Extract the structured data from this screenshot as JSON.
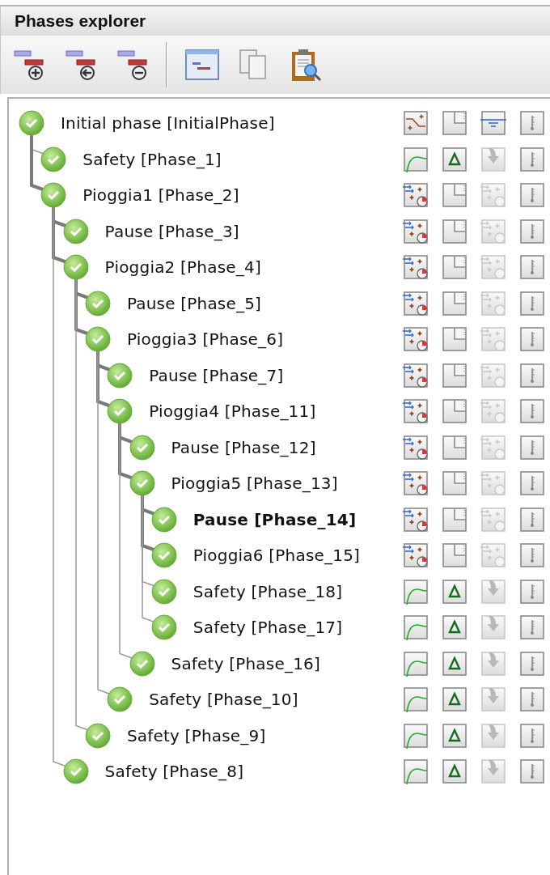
{
  "panel": {
    "title": "Phases explorer"
  },
  "phases": [
    {
      "name": "Initial phase [InitialPhase]",
      "kind": "initial",
      "selected": false,
      "children": [
        {
          "name": "Safety [Phase_1]",
          "kind": "safety",
          "selected": false
        },
        {
          "name": "Pioggia1 [Phase_2]",
          "kind": "plastic",
          "selected": false,
          "children": [
            {
              "name": "Pause [Phase_3]",
              "kind": "plastic",
              "selected": false
            },
            {
              "name": "Pioggia2 [Phase_4]",
              "kind": "plastic",
              "selected": false,
              "children": [
                {
                  "name": "Pause [Phase_5]",
                  "kind": "plastic",
                  "selected": false
                },
                {
                  "name": "Pioggia3 [Phase_6]",
                  "kind": "plastic",
                  "selected": false,
                  "children": [
                    {
                      "name": "Pause [Phase_7]",
                      "kind": "plastic",
                      "selected": false
                    },
                    {
                      "name": "Pioggia4 [Phase_11]",
                      "kind": "plastic",
                      "selected": false,
                      "children": [
                        {
                          "name": "Pause [Phase_12]",
                          "kind": "plastic",
                          "selected": false
                        },
                        {
                          "name": "Pioggia5 [Phase_13]",
                          "kind": "plastic",
                          "selected": false,
                          "children": [
                            {
                              "name": "Pause [Phase_14]",
                              "kind": "plastic",
                              "selected": true
                            },
                            {
                              "name": "Pioggia6 [Phase_15]",
                              "kind": "plastic",
                              "selected": false
                            },
                            {
                              "name": "Safety [Phase_18]",
                              "kind": "safety",
                              "selected": false
                            },
                            {
                              "name": "Safety [Phase_17]",
                              "kind": "safety",
                              "selected": false
                            }
                          ]
                        },
                        {
                          "name": "Safety [Phase_16]",
                          "kind": "safety",
                          "selected": false
                        }
                      ]
                    },
                    {
                      "name": "Safety [Phase_10]",
                      "kind": "safety",
                      "selected": false
                    }
                  ]
                },
                {
                  "name": "Safety [Phase_9]",
                  "kind": "safety",
                  "selected": false
                }
              ]
            },
            {
              "name": "Safety [Phase_8]",
              "kind": "safety",
              "selected": false
            }
          ]
        }
      ]
    }
  ]
}
